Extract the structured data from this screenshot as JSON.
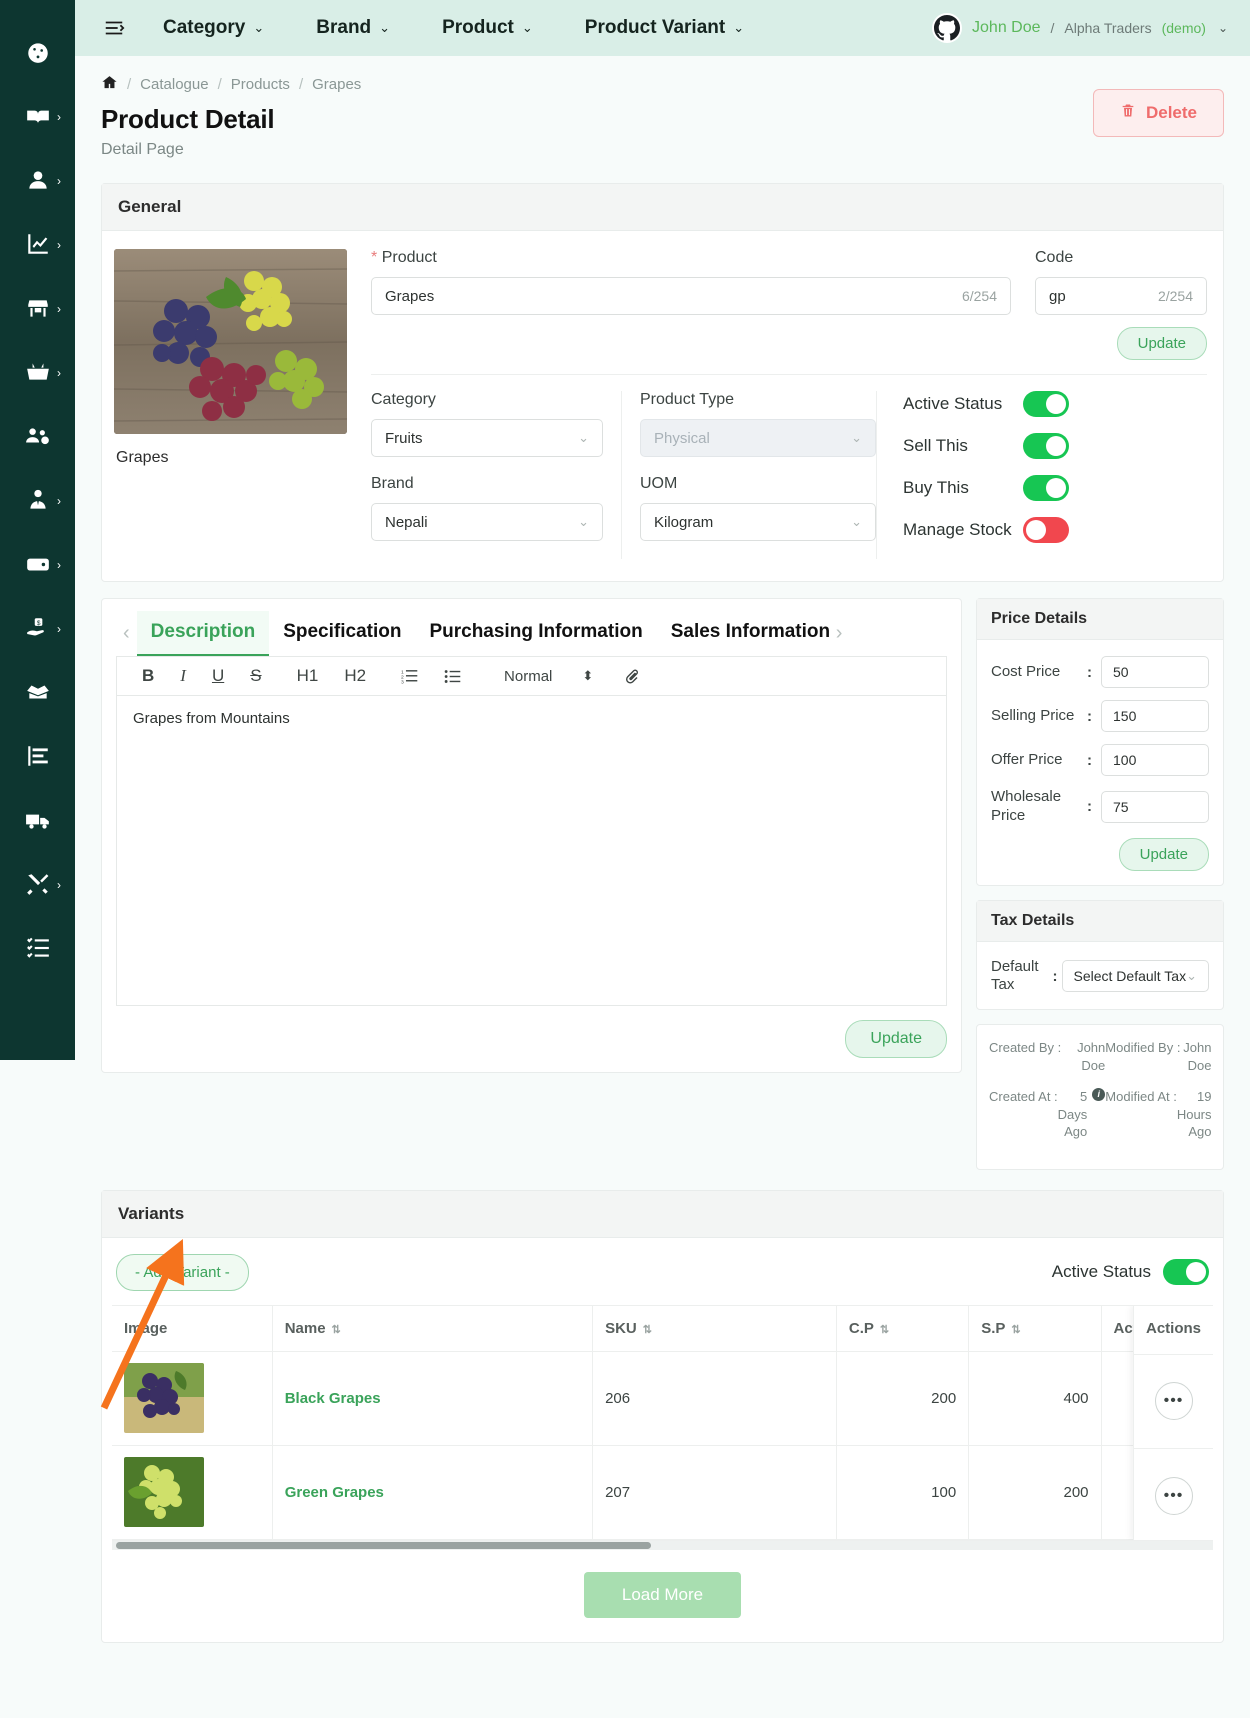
{
  "sidebar": {
    "items": [
      {
        "name": "dashboard",
        "icon": "dashboard-icon",
        "expandable": false
      },
      {
        "name": "catalogue",
        "icon": "book-icon",
        "expandable": true
      },
      {
        "name": "customers",
        "icon": "user-icon",
        "expandable": true
      },
      {
        "name": "reports",
        "icon": "chart-line-icon",
        "expandable": true
      },
      {
        "name": "store",
        "icon": "store-icon",
        "expandable": true
      },
      {
        "name": "sales",
        "icon": "basket-icon",
        "expandable": true
      },
      {
        "name": "team",
        "icon": "users-cog-icon",
        "expandable": false
      },
      {
        "name": "employees",
        "icon": "person-tie-icon",
        "expandable": true
      },
      {
        "name": "wallet",
        "icon": "wallet-icon",
        "expandable": true
      },
      {
        "name": "payments",
        "icon": "hand-money-icon",
        "expandable": true
      },
      {
        "name": "inventory",
        "icon": "open-box-icon",
        "expandable": false
      },
      {
        "name": "statements",
        "icon": "bar-chart-icon",
        "expandable": false
      },
      {
        "name": "delivery",
        "icon": "truck-icon",
        "expandable": false
      },
      {
        "name": "tools",
        "icon": "tools-icon",
        "expandable": true
      },
      {
        "name": "tasks",
        "icon": "checklist-icon",
        "expandable": false
      }
    ]
  },
  "topnav": {
    "menu_icon": "hamburger-menu-icon",
    "links": [
      {
        "label": "Category"
      },
      {
        "label": "Brand"
      },
      {
        "label": "Product"
      },
      {
        "label": "Product Variant"
      }
    ],
    "user": {
      "avatar_icon": "github-avatar-icon",
      "name": "John Doe",
      "separator": "/",
      "org": "Alpha Traders",
      "demo": "(demo)",
      "caret": "chevron-down-icon"
    }
  },
  "breadcrumb": {
    "home_icon": "home-icon",
    "items": [
      "Catalogue",
      "Products",
      "Grapes"
    ],
    "separator": "/"
  },
  "page": {
    "title": "Product Detail",
    "subtitle": "Detail Page",
    "delete_label": "Delete",
    "delete_icon": "trash-icon"
  },
  "general": {
    "header": "General",
    "thumbnail_caption": "Grapes",
    "product": {
      "label": "Product",
      "required_mark": "*",
      "value": "Grapes",
      "counter": "6/254"
    },
    "code": {
      "label": "Code",
      "value": "gp",
      "counter": "2/254"
    },
    "update_label": "Update",
    "category": {
      "label": "Category",
      "value": "Fruits"
    },
    "brand": {
      "label": "Brand",
      "value": "Nepali"
    },
    "product_type": {
      "label": "Product Type",
      "value": "Physical",
      "disabled": true
    },
    "uom": {
      "label": "UOM",
      "value": "Kilogram"
    },
    "toggles": [
      {
        "label": "Active Status",
        "state": "on"
      },
      {
        "label": "Sell This",
        "state": "on"
      },
      {
        "label": "Buy This",
        "state": "on"
      },
      {
        "label": "Manage Stock",
        "state": "off"
      }
    ]
  },
  "editor": {
    "tabs": [
      {
        "label": "Description",
        "active": true
      },
      {
        "label": "Specification",
        "active": false
      },
      {
        "label": "Purchasing Information",
        "active": false
      },
      {
        "label": "Sales Information",
        "active": false
      }
    ],
    "prev_arrow": "chevron-left-icon",
    "next_arrow": "chevron-right-icon",
    "toolbar": {
      "bold": "B",
      "italic": "I",
      "underline": "U",
      "strike": "S",
      "h1": "H1",
      "h2": "H2",
      "ordered_list_icon": "ordered-list-icon",
      "bullet_list_icon": "bullet-list-icon",
      "format": "Normal",
      "spinner": "updown-arrows-icon",
      "attach_icon": "paperclip-icon"
    },
    "content": "Grapes from Mountains",
    "update_label": "Update"
  },
  "price_details": {
    "header": "Price Details",
    "rows": [
      {
        "label": "Cost Price",
        "colon": ":",
        "value": "50"
      },
      {
        "label": "Selling Price",
        "colon": ":",
        "value": "150"
      },
      {
        "label": "Offer Price",
        "colon": ":",
        "value": "100"
      },
      {
        "label": "Wholesale Price",
        "colon": ":",
        "value": "75"
      }
    ],
    "update_label": "Update"
  },
  "tax_details": {
    "header": "Tax Details",
    "label": "Default Tax",
    "colon": ":",
    "placeholder": "Select Default Tax"
  },
  "meta": {
    "created_by_label": "Created By :",
    "created_by_value": "John Doe",
    "created_at_label": "Created At :",
    "created_at_value": "5 Days Ago",
    "modified_by_label": "Modified By :",
    "modified_by_value": "John Doe",
    "modified_at_label": "Modified At :",
    "modified_at_value": "19 Hours Ago",
    "info_icon": "info-icon"
  },
  "variants": {
    "header": "Variants",
    "add_label": "- Add Variant -",
    "active_status_label": "Active Status",
    "active_status_state": "on",
    "columns": [
      "Image",
      "Name",
      "SKU",
      "C.P",
      "S.P",
      "Actions"
    ],
    "rows": [
      {
        "image": "black-grapes-thumbnail",
        "name": "Black Grapes",
        "sku": "206",
        "cp": "200",
        "sp": "400",
        "action_icon": "ellipsis-icon"
      },
      {
        "image": "green-grapes-thumbnail",
        "name": "Green Grapes",
        "sku": "207",
        "cp": "100",
        "sp": "200",
        "action_icon": "ellipsis-icon"
      }
    ],
    "load_more_label": "Load More"
  },
  "annotation": {
    "arrow_color": "#f5731d"
  },
  "colors": {
    "sidebar_bg": "#0d3630",
    "topnav_bg": "#d9eee7",
    "accent_green": "#3aa35a",
    "toggle_on": "#17c653",
    "toggle_off": "#f1474e",
    "delete_red": "#ef6c6c",
    "page_bg": "#f7fbfa"
  }
}
